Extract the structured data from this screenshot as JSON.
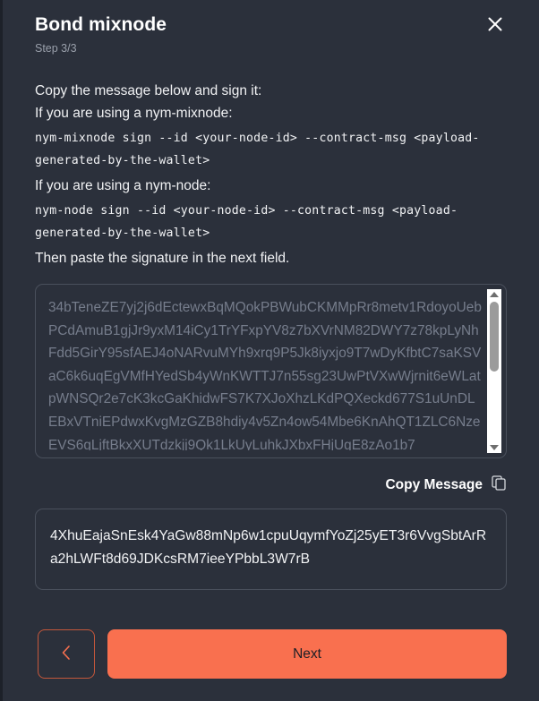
{
  "header": {
    "title": "Bond mixnode",
    "step": "Step 3/3",
    "close_icon": "close-icon"
  },
  "instructions": {
    "line1": "Copy the message below and sign it:",
    "line2": "If you are using a nym-mixnode:",
    "command1": "nym-mixnode sign --id <your-node-id> --contract-msg <payload-generated-by-the-wallet>",
    "line3": "If you are using a nym-node:",
    "command2": "nym-node sign --id <your-node-id> --contract-msg <payload-generated-by-the-wallet>",
    "line4": "Then paste the signature in the next field."
  },
  "message_box": {
    "value": "34bTeneZE7yj2j6dEctewxBqMQokPBWubCKMMpRr8metv1RdoyoUebPCdAmuB1gjJr9yxM14iCy1TrYFxpYV8z7bXVrNM82DWY7z78kpLyNhFdd5GirY95sfAEJ4oNARvuMYh9xrq9P5Jk8iyxjo9T7wDyKfbtC7saKSVaC6k6uqEgVMfHYedSb4yWnKWTTJ7n55sg23UwPtVXwWjrnit6eWLatpWNSQr2e7cK3kcGaKhidwFS7K7XJoXhzLKdPQXeckd677S1uUnDLEBxVTniEPdwxKvgMzGZB8hdiy4v5Zn4ow54Mbe6KnAhQT1ZLC6NzeEVS6gLjftBkxXUTdzkjj9Qk1LkUyLuhkJXbxFHjUgE8zAo1b7",
    "scrollbar_up_icon": "scroll-up-arrow-icon",
    "scrollbar_down_icon": "scroll-down-arrow-icon"
  },
  "copy": {
    "label": "Copy Message",
    "icon": "copy-icon"
  },
  "signature": {
    "value": "4XhuEajaSnEsk4YaGw88mNp6w1cpuUqymfYoZj25yET3r6VvgSbtArRa2hLWFt8d69JDKcsRM7ieeYPbbL3W7rB"
  },
  "footer": {
    "back_icon": "chevron-left-icon",
    "next_label": "Next"
  },
  "colors": {
    "background": "#2b303b",
    "accent": "#f9704f",
    "border": "#4a505c",
    "muted_text": "#767d8c"
  }
}
